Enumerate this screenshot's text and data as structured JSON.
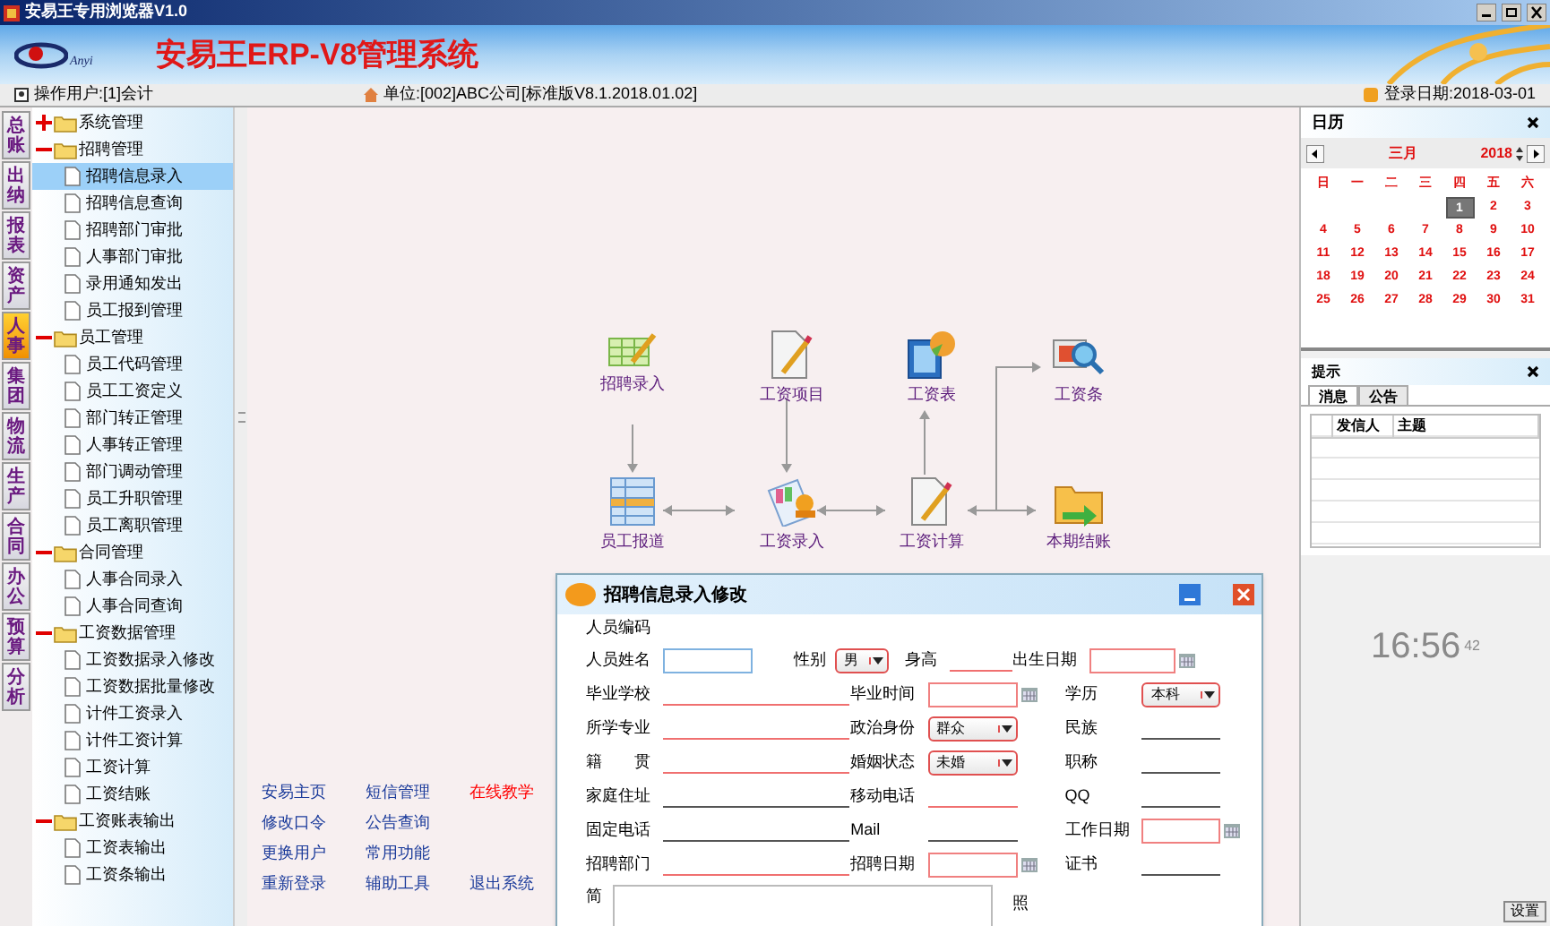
{
  "window": {
    "title": "安易王专用浏览器V1.0"
  },
  "header": {
    "logo_text": "Anyi",
    "title": "安易王ERP-V8管理系统"
  },
  "info_bar": {
    "user": "操作用户:[1]会计",
    "unit": "单位:[002]ABC公司[标准版V8.1.2018.01.02]",
    "login_date": "登录日期:2018-03-01"
  },
  "module_tabs": [
    {
      "label": "总账",
      "selected": false
    },
    {
      "label": "出纳",
      "selected": false
    },
    {
      "label": "报表",
      "selected": false
    },
    {
      "label": "资产",
      "selected": false
    },
    {
      "label": "人事",
      "selected": true
    },
    {
      "label": "集团",
      "selected": false
    },
    {
      "label": "物流",
      "selected": false
    },
    {
      "label": "生产",
      "selected": false
    },
    {
      "label": "合同",
      "selected": false
    },
    {
      "label": "办公",
      "selected": false
    },
    {
      "label": "预算",
      "selected": false
    },
    {
      "label": "分析",
      "selected": false
    }
  ],
  "tree": [
    {
      "label": "系统管理",
      "expanded": false
    },
    {
      "label": "招聘管理",
      "expanded": true,
      "children": [
        {
          "label": "招聘信息录入",
          "selected": true
        },
        {
          "label": "招聘信息查询",
          "selected": false
        },
        {
          "label": "招聘部门审批",
          "selected": false
        },
        {
          "label": "人事部门审批",
          "selected": false
        },
        {
          "label": "录用通知发出",
          "selected": false
        },
        {
          "label": "员工报到管理",
          "selected": false
        }
      ]
    },
    {
      "label": "员工管理",
      "expanded": true,
      "children": [
        {
          "label": "员工代码管理",
          "selected": false
        },
        {
          "label": "员工工资定义",
          "selected": false
        },
        {
          "label": "部门转正管理",
          "selected": false
        },
        {
          "label": "人事转正管理",
          "selected": false
        },
        {
          "label": "部门调动管理",
          "selected": false
        },
        {
          "label": "员工升职管理",
          "selected": false
        },
        {
          "label": "员工离职管理",
          "selected": false
        }
      ]
    },
    {
      "label": "合同管理",
      "expanded": true,
      "children": [
        {
          "label": "人事合同录入",
          "selected": false
        },
        {
          "label": "人事合同查询",
          "selected": false
        }
      ]
    },
    {
      "label": "工资数据管理",
      "expanded": true,
      "children": [
        {
          "label": "工资数据录入修改",
          "selected": false
        },
        {
          "label": "工资数据批量修改",
          "selected": false
        },
        {
          "label": "计件工资录入",
          "selected": false
        },
        {
          "label": "计件工资计算",
          "selected": false
        },
        {
          "label": "工资计算",
          "selected": false
        },
        {
          "label": "工资结账",
          "selected": false
        }
      ]
    },
    {
      "label": "工资账表输出",
      "expanded": true,
      "children": [
        {
          "label": "工资表输出",
          "selected": false
        },
        {
          "label": "工资条输出",
          "selected": false
        }
      ]
    }
  ],
  "flow": {
    "nodes": [
      {
        "label": "招聘录入",
        "kind": "sheet"
      },
      {
        "label": "工资项目",
        "kind": "doc"
      },
      {
        "label": "工资表",
        "kind": "book"
      },
      {
        "label": "工资条",
        "kind": "search"
      },
      {
        "label": "员工报道",
        "kind": "table"
      },
      {
        "label": "工资录入",
        "kind": "stamp"
      },
      {
        "label": "工资计算",
        "kind": "doc"
      },
      {
        "label": "本期结账",
        "kind": "folder"
      }
    ]
  },
  "quick_links": [
    [
      {
        "text": "安易主页",
        "color": "#1a3a9a"
      },
      {
        "text": "短信管理",
        "color": "#1a3a9a"
      },
      {
        "text": "在线教学",
        "color": "#ff0000"
      }
    ],
    [
      {
        "text": "修改口令",
        "color": "#1a3a9a"
      },
      {
        "text": "公告查询",
        "color": "#1a3a9a"
      }
    ],
    [
      {
        "text": "更换用户",
        "color": "#1a3a9a"
      },
      {
        "text": "常用功能",
        "color": "#1a3a9a"
      }
    ],
    [
      {
        "text": "重新登录",
        "color": "#1a3a9a"
      },
      {
        "text": "辅助工具",
        "color": "#1a3a9a"
      },
      {
        "text": "退出系统",
        "color": "#1a3a9a"
      }
    ]
  ],
  "calendar": {
    "title": "日历",
    "month": "三月",
    "year": "2018",
    "weekdays": [
      "日",
      "一",
      "二",
      "三",
      "四",
      "五",
      "六"
    ],
    "days": [
      {
        "d": "1",
        "selected": true
      },
      {
        "d": "2",
        "selected": false
      },
      {
        "d": "3",
        "selected": false
      },
      {
        "d": "4",
        "selected": false
      },
      {
        "d": "5",
        "selected": false
      },
      {
        "d": "6",
        "selected": false
      },
      {
        "d": "7",
        "selected": false
      },
      {
        "d": "8",
        "selected": false
      },
      {
        "d": "9",
        "selected": false
      },
      {
        "d": "10",
        "selected": false
      },
      {
        "d": "11",
        "selected": false
      },
      {
        "d": "12",
        "selected": false
      },
      {
        "d": "13",
        "selected": false
      },
      {
        "d": "14",
        "selected": false
      },
      {
        "d": "15",
        "selected": false
      },
      {
        "d": "16",
        "selected": false
      },
      {
        "d": "17",
        "selected": false
      },
      {
        "d": "18",
        "selected": false
      },
      {
        "d": "19",
        "selected": false
      },
      {
        "d": "20",
        "selected": false
      },
      {
        "d": "21",
        "selected": false
      },
      {
        "d": "22",
        "selected": false
      },
      {
        "d": "23",
        "selected": false
      },
      {
        "d": "24",
        "selected": false
      },
      {
        "d": "25",
        "selected": false
      },
      {
        "d": "26",
        "selected": false
      },
      {
        "d": "27",
        "selected": false
      },
      {
        "d": "28",
        "selected": false
      },
      {
        "d": "29",
        "selected": false
      },
      {
        "d": "30",
        "selected": false
      },
      {
        "d": "31",
        "selected": false
      }
    ]
  },
  "tips": {
    "title": "提示",
    "tabs": [
      {
        "label": "消息",
        "selected": true
      },
      {
        "label": "公告",
        "selected": false
      }
    ],
    "columns": [
      "发信人",
      "主题"
    ]
  },
  "clock": {
    "time": "16:56",
    "seconds": "42"
  },
  "settings_button": "设置",
  "dialog": {
    "title": "招聘信息录入修改",
    "rows": [
      [
        {
          "label": "人员编码",
          "kind": "none"
        }
      ],
      [
        {
          "label": "人员姓名",
          "kind": "input"
        },
        {
          "label": "性别",
          "kind": "select",
          "value": "男"
        },
        {
          "label": "身高",
          "kind": "line",
          "required": true
        },
        {
          "label": "出生日期",
          "kind": "date"
        }
      ],
      [
        {
          "label": "毕业学校",
          "kind": "line",
          "required": true
        },
        {
          "label": "毕业时间",
          "kind": "date"
        },
        {
          "label": "学历",
          "kind": "select",
          "value": "本科"
        }
      ],
      [
        {
          "label": "所学专业",
          "kind": "line",
          "required": true
        },
        {
          "label": "政治身份",
          "kind": "select",
          "value": "群众"
        },
        {
          "label": "民族",
          "kind": "line",
          "required": false
        }
      ],
      [
        {
          "label": "籍　　贯",
          "kind": "line",
          "required": true
        },
        {
          "label": "婚姻状态",
          "kind": "select",
          "value": "未婚"
        },
        {
          "label": "职称",
          "kind": "line",
          "required": false
        }
      ],
      [
        {
          "label": "家庭住址",
          "kind": "line",
          "required": false
        },
        {
          "label": "移动电话",
          "kind": "line",
          "required": true
        },
        {
          "label": "QQ",
          "kind": "line",
          "required": false
        }
      ],
      [
        {
          "label": "固定电话",
          "kind": "line",
          "required": false
        },
        {
          "label": "Mail",
          "kind": "line",
          "required": false
        },
        {
          "label": "工作日期",
          "kind": "date"
        }
      ],
      [
        {
          "label": "招聘部门",
          "kind": "line",
          "required": true
        },
        {
          "label": "招聘日期",
          "kind": "date"
        },
        {
          "label": "证书",
          "kind": "line",
          "required": false
        }
      ]
    ],
    "resume_row": {
      "label": "简",
      "photo_label": "照"
    }
  }
}
